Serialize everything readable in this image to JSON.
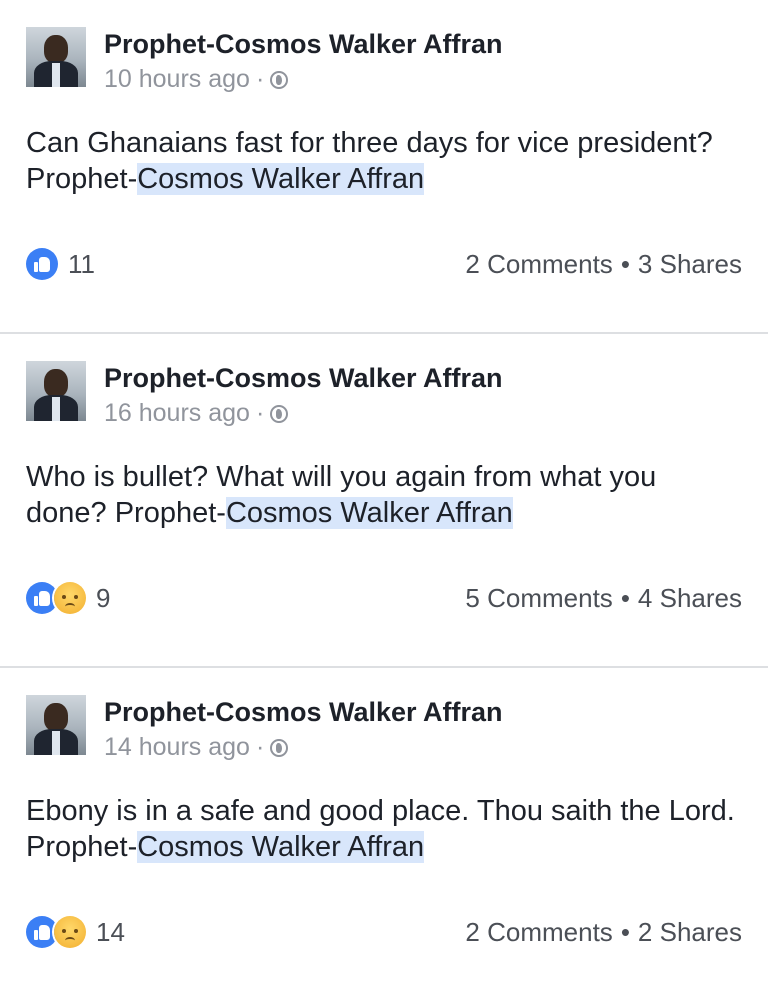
{
  "posts": [
    {
      "author": "Prophet-Cosmos Walker Affran",
      "time": "10 hours ago",
      "text_plain": "Can Ghanaians fast for three days for vice president? Prophet-",
      "text_highlight": "Cosmos Walker Affran",
      "reactions": [
        "like-icon"
      ],
      "reaction_count": "11",
      "comments": "2 Comments",
      "shares": "3 Shares"
    },
    {
      "author": "Prophet-Cosmos Walker Affran",
      "time": "16 hours ago",
      "text_plain": "Who is bullet? What will you again from what you done? Prophet-",
      "text_highlight": "Cosmos Walker Affran",
      "reactions": [
        "like-icon",
        "sad-icon"
      ],
      "reaction_count": "9",
      "comments": "5 Comments",
      "shares": "4 Shares"
    },
    {
      "author": "Prophet-Cosmos Walker Affran",
      "time": "14 hours ago",
      "text_plain": "Ebony is in a safe and good place. Thou saith the Lord. Prophet-",
      "text_highlight": "Cosmos Walker Affran",
      "reactions": [
        "like-icon",
        "sad-icon"
      ],
      "reaction_count": "14",
      "comments": "2 Comments",
      "shares": "2 Shares"
    }
  ],
  "colors": {
    "like_blue": "#3b7ff5",
    "highlight": "#d8e6fb",
    "meta_gray": "#90949c",
    "divider": "#dddfe2"
  },
  "separator": "·",
  "stats_separator": "•"
}
